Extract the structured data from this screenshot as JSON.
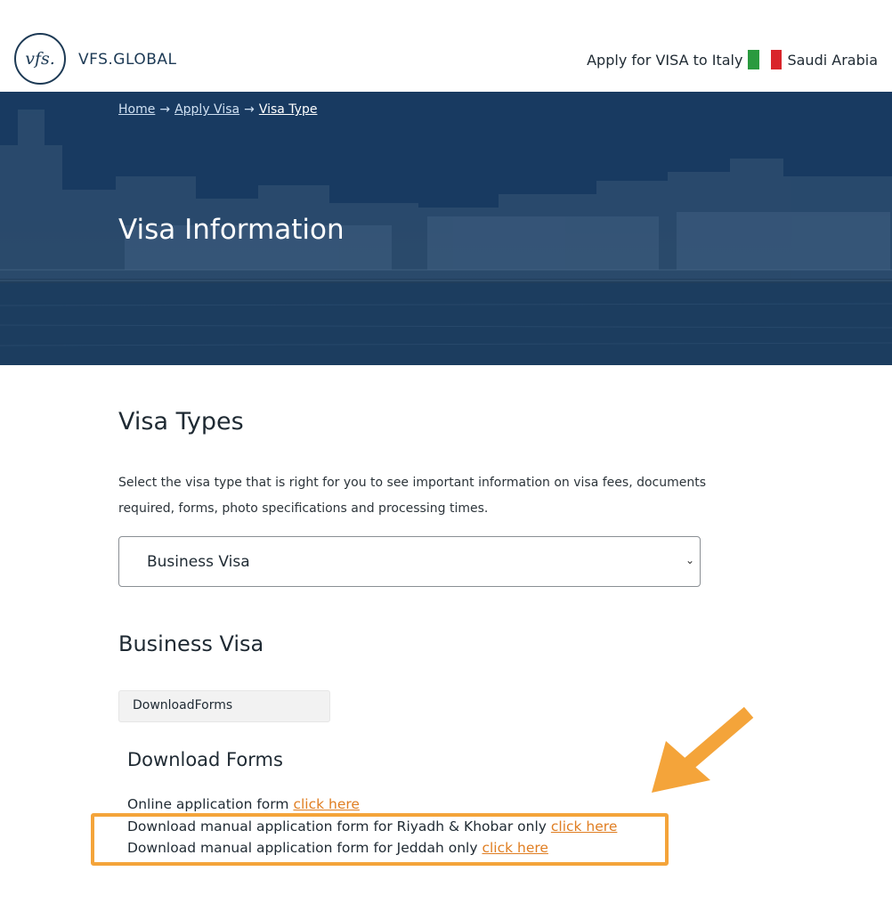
{
  "header": {
    "logo_text": "vfs.",
    "brand": "VFS.GLOBAL",
    "apply_text": "Apply for VISA to Italy",
    "country": "Saudi Arabia",
    "flag_colors": [
      "#2a9a3f",
      "#ffffff",
      "#d9252b"
    ]
  },
  "breadcrumb": {
    "items": [
      "Home",
      "Apply Visa",
      "Visa Type"
    ],
    "separator": "→"
  },
  "hero": {
    "title": "Visa Information"
  },
  "visa_types": {
    "title": "Visa Types",
    "description": "Select the visa type that is right for you to see important information on visa fees, documents required, forms, photo specifications and processing times.",
    "select_value": "Business Visa",
    "select_chevron": "⌄"
  },
  "business_visa": {
    "title": "Business Visa",
    "tab_label": "DownloadForms"
  },
  "download_forms": {
    "title": "Download Forms",
    "lines": [
      {
        "text": "Online application form",
        "link": "click here"
      },
      {
        "text": "Download manual application form for Riyadh & Khobar only",
        "link": "click here"
      },
      {
        "text": "Download manual application form for Jeddah only",
        "link": "click here"
      }
    ]
  },
  "colors": {
    "accent": "#e07e22",
    "annotation": "#f4a43a",
    "hero": "#1a3d63"
  }
}
